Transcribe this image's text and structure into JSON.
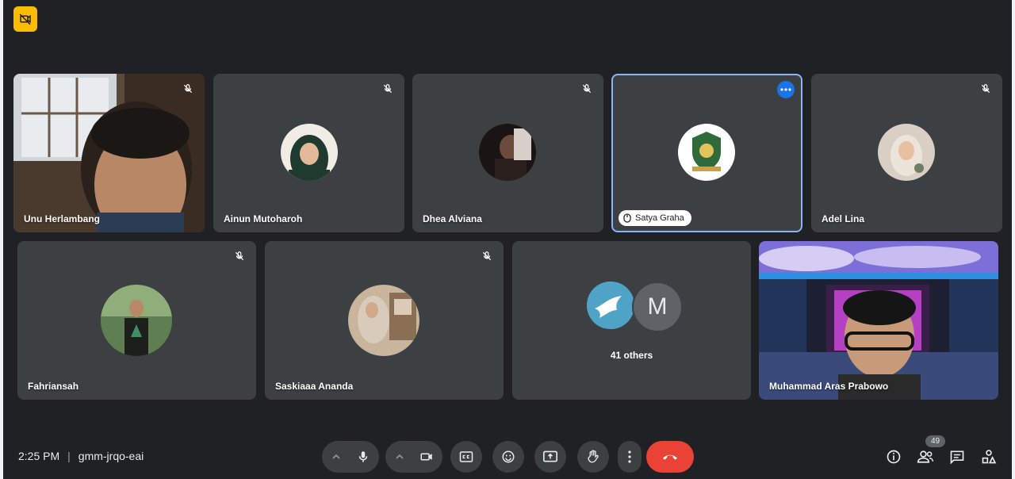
{
  "meeting": {
    "time": "2:25 PM",
    "separator": "|",
    "code": "gmm-jrqo-eai"
  },
  "participants_row1": [
    {
      "name": "Unu Herlambang",
      "type": "video"
    },
    {
      "name": "Ainun Mutoharoh",
      "type": "avatar"
    },
    {
      "name": "Dhea Alviana",
      "type": "avatar"
    },
    {
      "name": "Satya Graha",
      "type": "presenting"
    },
    {
      "name": "Adel Lina",
      "type": "avatar"
    }
  ],
  "participants_row2": [
    {
      "name": "Fahriansah",
      "type": "avatar"
    },
    {
      "name": "Saskiaaa Ananda",
      "type": "avatar"
    },
    {
      "name": "Muhammad Aras Prabowo",
      "type": "video"
    }
  ],
  "others": {
    "label": "41 others",
    "initial": "M"
  },
  "people_count": "49",
  "colors": {
    "background": "#202124",
    "tile": "#3c4043",
    "end_call": "#ea4335",
    "active_border": "#8ab4f8",
    "badge": "#fbbc04"
  },
  "icons": [
    "camera-off-icon",
    "mic-off-icon",
    "more-options-icon",
    "mic-icon",
    "camera-icon",
    "captions-icon",
    "emoji-icon",
    "present-icon",
    "raise-hand-icon",
    "more-vert-icon",
    "end-call-icon",
    "info-icon",
    "people-icon",
    "chat-icon",
    "activities-icon"
  ]
}
